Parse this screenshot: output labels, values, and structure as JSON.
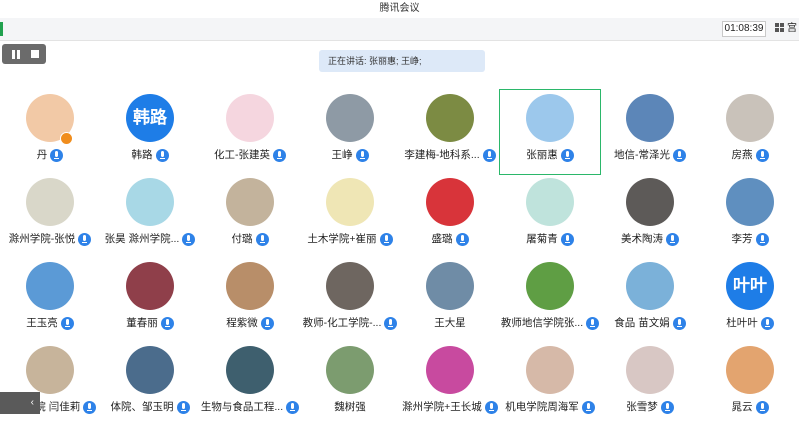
{
  "window": {
    "title": "腾讯会议"
  },
  "toolbar": {
    "timer": "01:08:39",
    "layout_label": "宫"
  },
  "speaking_banner": "正在讲话: 张丽惠; 王峥;",
  "collapse_glyph": "‹",
  "participants": [
    {
      "name": "丹",
      "avatar_text": "",
      "color": "#f2c9a6",
      "mic": true,
      "badge": true
    },
    {
      "name": "韩路",
      "avatar_text": "韩路",
      "color": "#1e7de7",
      "mic": true
    },
    {
      "name": "化工-张建英",
      "avatar_text": "",
      "color": "#f5d6df",
      "mic": true
    },
    {
      "name": "王峥",
      "avatar_text": "",
      "color": "#8e9aa5",
      "mic": true
    },
    {
      "name": "李建梅-地科系...",
      "avatar_text": "",
      "color": "#7c8b43",
      "mic": true
    },
    {
      "name": "张丽惠",
      "avatar_text": "",
      "color": "#9cc8ec",
      "mic": true,
      "active": true
    },
    {
      "name": "地信-常泽光",
      "avatar_text": "",
      "color": "#5c86b8",
      "mic": true
    },
    {
      "name": "房燕",
      "avatar_text": "",
      "color": "#c9c2ba",
      "mic": true
    },
    {
      "name": "滁州学院-张悦",
      "avatar_text": "",
      "color": "#d9d7c9",
      "mic": true
    },
    {
      "name": "张昊 滁州学院...",
      "avatar_text": "",
      "color": "#a8d8e6",
      "mic": true
    },
    {
      "name": "付璐",
      "avatar_text": "",
      "color": "#c3b39c",
      "mic": true
    },
    {
      "name": "土木学院+崔丽",
      "avatar_text": "",
      "color": "#efe6b5",
      "mic": true
    },
    {
      "name": "盛璐",
      "avatar_text": "",
      "color": "#d8343a",
      "mic": true
    },
    {
      "name": "屠菊青",
      "avatar_text": "",
      "color": "#bfe3dc",
      "mic": true
    },
    {
      "name": "美术陶涛",
      "avatar_text": "",
      "color": "#5d5a58",
      "mic": true
    },
    {
      "name": "李芳",
      "avatar_text": "",
      "color": "#5f8fbf",
      "mic": true
    },
    {
      "name": "王玉亮",
      "avatar_text": "",
      "color": "#5b9ad6",
      "mic": true
    },
    {
      "name": "董春丽",
      "avatar_text": "",
      "color": "#8f3f4a",
      "mic": true
    },
    {
      "name": "程紫微",
      "avatar_text": "",
      "color": "#b88e69",
      "mic": true
    },
    {
      "name": "教师-化工学院-...",
      "avatar_text": "",
      "color": "#6e6660",
      "mic": true
    },
    {
      "name": "王大星",
      "avatar_text": "",
      "color": "#6f8ca6",
      "mic": false
    },
    {
      "name": "教师地信学院张...",
      "avatar_text": "",
      "color": "#5f9e44",
      "mic": true
    },
    {
      "name": "食品 苗文娟",
      "avatar_text": "",
      "color": "#7bb1d9",
      "mic": true
    },
    {
      "name": "杜叶叶",
      "avatar_text": "叶叶",
      "color": "#1e7de7",
      "mic": true
    },
    {
      "name": "土木学院 闫佳莉",
      "avatar_text": "",
      "color": "#c7b49b",
      "mic": true
    },
    {
      "name": "体院、邹玉明",
      "avatar_text": "",
      "color": "#4b6c8c",
      "mic": true
    },
    {
      "name": "生物与食品工程...",
      "avatar_text": "",
      "color": "#3e5f6e",
      "mic": true
    },
    {
      "name": "魏树强",
      "avatar_text": "",
      "color": "#7c9c6f",
      "mic": false
    },
    {
      "name": "滁州学院+王长城",
      "avatar_text": "",
      "color": "#c84a9f",
      "mic": true
    },
    {
      "name": "机电学院周海军",
      "avatar_text": "",
      "color": "#d6b9a8",
      "mic": true
    },
    {
      "name": "张雪梦",
      "avatar_text": "",
      "color": "#d8c7c4",
      "mic": true
    },
    {
      "name": "晁云",
      "avatar_text": "",
      "color": "#e3a46f",
      "mic": true
    }
  ]
}
